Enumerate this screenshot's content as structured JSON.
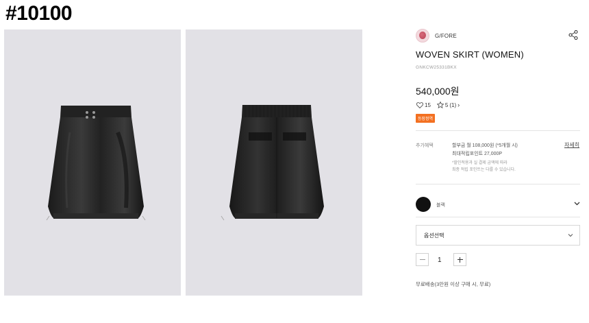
{
  "page_id": "#10100",
  "brand": {
    "name": "G/FORE"
  },
  "product": {
    "title": "WOVEN SKIRT (WOMEN)",
    "code": "GNKCW25331BKX",
    "price": "540,000원",
    "likes": "15",
    "rating": "5",
    "review_count": "(1)",
    "badge": "등장정역"
  },
  "benefits": {
    "label": "추가혜택",
    "line1": "할부금 월 108,000원 (*5개월 시)",
    "line2": "최대적립포인트 27,000P",
    "note1": "*할인적용과 실 결제 금액에 따라",
    "note2": "최종 적립 포인트는 다를 수 있습니다.",
    "detail_link": "자세히"
  },
  "color_option": {
    "label": "블랙",
    "swatch": "#111111"
  },
  "option_select": {
    "label": "옵션선택"
  },
  "quantity": {
    "value": "1"
  },
  "shipping": {
    "note": "무료배송(3만원 이상 구매 시, 무료)"
  },
  "colors": {
    "accent_badge": "#f37021",
    "image_bg": "#e2e1e6"
  },
  "icons": [
    "share-icon",
    "heart-icon",
    "star-icon",
    "chevron-right-icon",
    "chevron-down-icon",
    "minus-icon",
    "plus-icon"
  ]
}
